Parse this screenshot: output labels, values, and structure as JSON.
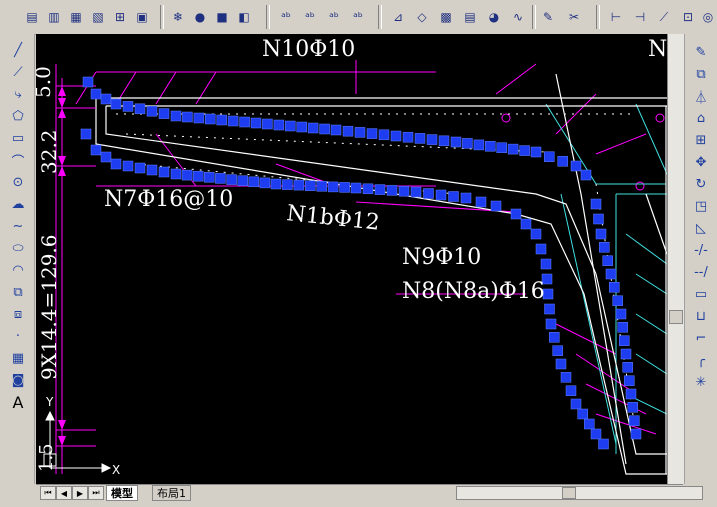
{
  "toolbar": {
    "icons": [
      "layer-icon",
      "layer-state-icon",
      "layer-prev-icon",
      "layer-iso-icon",
      "layer-match-icon",
      "layer-walk-icon",
      "snowflake-icon",
      "bulb-icon",
      "lock-icon",
      "unlock-icon",
      "text-abc-icon",
      "text-edit-icon",
      "text-abcd-icon",
      "text-style-icon",
      "dim-icon",
      "dim-edit-icon",
      "block-icon",
      "chart-icon",
      "sphere-icon",
      "wave-icon",
      "pencil-icon",
      "scissors-icon",
      "align-icon",
      "dim-linear-icon",
      "dim-aligned-icon",
      "dim-ordinate-icon"
    ]
  },
  "left_toolbar": {
    "tools": [
      "line-icon",
      "construction-line-icon",
      "polyline-icon",
      "polygon-icon",
      "rectangle-icon",
      "arc-icon",
      "circle-icon",
      "revcloud-icon",
      "spline-icon",
      "ellipse-icon",
      "ellipse-arc-icon",
      "insert-block-icon",
      "make-block-icon",
      "point-icon",
      "hatch-icon",
      "region-icon",
      "text-icon"
    ],
    "text_tool_label": "A"
  },
  "right_toolbar": {
    "tools": [
      "erase-icon",
      "copy-icon",
      "mirror-icon",
      "offset-icon",
      "array-icon",
      "move-icon",
      "rotate-icon",
      "scale-icon",
      "stretch-icon",
      "trim-icon",
      "extend-icon",
      "break-icon",
      "join-icon",
      "chamfer-icon",
      "fillet-icon",
      "explode-icon"
    ]
  },
  "drawing": {
    "labels": {
      "n10": "N10Φ10",
      "n_topright": "N",
      "n7": "N7Φ16@10",
      "n1b": "N1bΦ12",
      "n9": "N9Φ10",
      "n8": "N8(N8a)Φ16",
      "dim_top": "5.0",
      "dim_mid": "32.2",
      "dim_big": "9X14.4=129.6",
      "dim_bottom": "1.5"
    },
    "ucs": {
      "x": "X",
      "y": "Y"
    }
  },
  "bottom": {
    "tab_model": "模型",
    "tab_layout": "布局1"
  },
  "colors": {
    "rebar": "#1e3cf0",
    "outline": "#ffffff",
    "magenta": "#ff00ff",
    "cyan": "#40e0e0",
    "canvas": "#000000"
  }
}
